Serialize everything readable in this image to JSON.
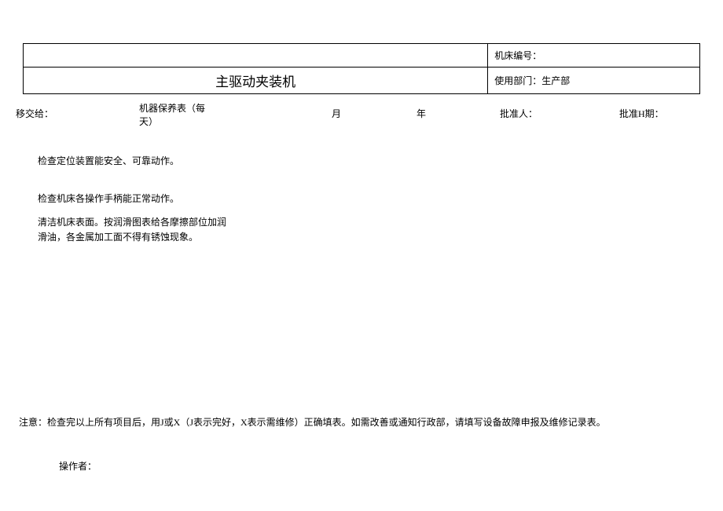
{
  "header": {
    "machine_number_label": "机床编号：",
    "title": "主驱动夹装机",
    "department_label": "使用部门：",
    "department_value": "生产部"
  },
  "meta": {
    "handover_label": "移交给：",
    "form_title_line1": "机器保养表（每",
    "form_title_line2": "天）",
    "month_label": "月",
    "year_label": "年",
    "approver_label": "批准人：",
    "approval_date_label": "批准H期："
  },
  "checks": {
    "item1": "检查定位装置能安全、可靠动作。",
    "item2": "检查机床各操作手柄能正常动作。",
    "item3_line1": "清洁机床表面。按润滑图表给各摩擦部位加润",
    "item3_line2": "滑油，各金属加工面不得有锈蚀现象。"
  },
  "note": "注意：检查完以上所有项目后，用J或X（J表示完好，X表示需维修）正确填表。如需改善或通知行政部，请填写设备故障申报及维修记录表。",
  "operator_label": "操作者："
}
